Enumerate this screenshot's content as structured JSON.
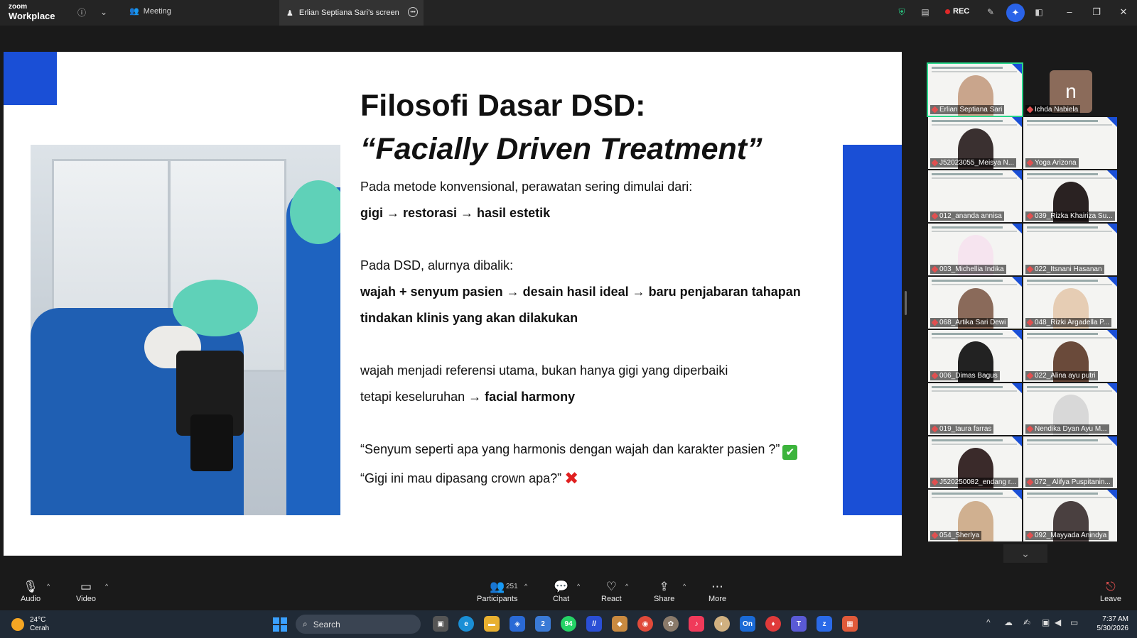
{
  "topbar": {
    "logo_line1": "zoom",
    "logo_line2": "Workplace",
    "meeting_label": "Meeting",
    "screen_tab_label": "Erlian Septiana Sari's screen",
    "rec_label": "REC"
  },
  "slide": {
    "title_line1": "Filosofi Dasar DSD:",
    "title_line2": "“Facially Driven Treatment”",
    "para1": "Pada metode konvensional, perawatan sering dimulai dari:",
    "para1_bold": "gigi → restorasi → hasil estetik",
    "para2": "Pada DSD, alurnya dibalik:",
    "para2_bold_line1": "wajah + senyum pasien → desain hasil ideal → baru penjabaran tahapan",
    "para2_bold_line2": "tindakan klinis yang akan dilakukan",
    "para3_line1": "wajah menjadi referensi utama, bukan hanya gigi yang diperbaiki",
    "para3_line2_prefix": "tetapi keseluruhan → ",
    "para3_line2_bold": "facial harmony",
    "quote_good": "“Senyum seperti apa yang harmonis dengan wajah dan karakter pasien ?”",
    "quote_bad": "“Gigi ini mau dipasang crown apa?”",
    "good_mark": "✔",
    "bad_mark": "✖"
  },
  "gallery": {
    "participants": [
      {
        "name": "Erlian Septiana Sari"
      },
      {
        "name": "Ichda Nabiela"
      },
      {
        "name": "J52023055_Meisya N..."
      },
      {
        "name": "Yoga Arizona"
      },
      {
        "name": "012_ananda annisa"
      },
      {
        "name": "039_Rizka Khairiza Su..."
      },
      {
        "name": "003_Michellia Indika"
      },
      {
        "name": "022_Itsnani Hasanan"
      },
      {
        "name": "068_Artika Sari Dewi"
      },
      {
        "name": "048_Rizki Argadella P..."
      },
      {
        "name": "006_Dimas Bagus"
      },
      {
        "name": "022_Alina ayu putri"
      },
      {
        "name": "019_taura farras"
      },
      {
        "name": "Nendika Dyan Ayu M..."
      },
      {
        "name": "J520250082_endang r..."
      },
      {
        "name": "072_ Alifya Puspitanin..."
      },
      {
        "name": "054_Sherlya"
      },
      {
        "name": "092_Mayyada Anindya"
      }
    ],
    "avatar_letter": "n"
  },
  "toolbar": {
    "audio": "Audio",
    "video": "Video",
    "participants": "Participants",
    "participants_count": "251",
    "chat": "Chat",
    "react": "React",
    "share": "Share",
    "more": "More",
    "leave": "Leave"
  },
  "taskbar": {
    "temperature": "24°C",
    "weather": "Cerah",
    "search": "Search",
    "time": "7:37 AM",
    "date": "5/30/2026",
    "whatsapp_badge": "94",
    "store_badge": "2"
  },
  "colors": {
    "slide_blue": "#1a4fd6",
    "active_speaker": "#2ad68a",
    "rec_red": "#e02828"
  }
}
